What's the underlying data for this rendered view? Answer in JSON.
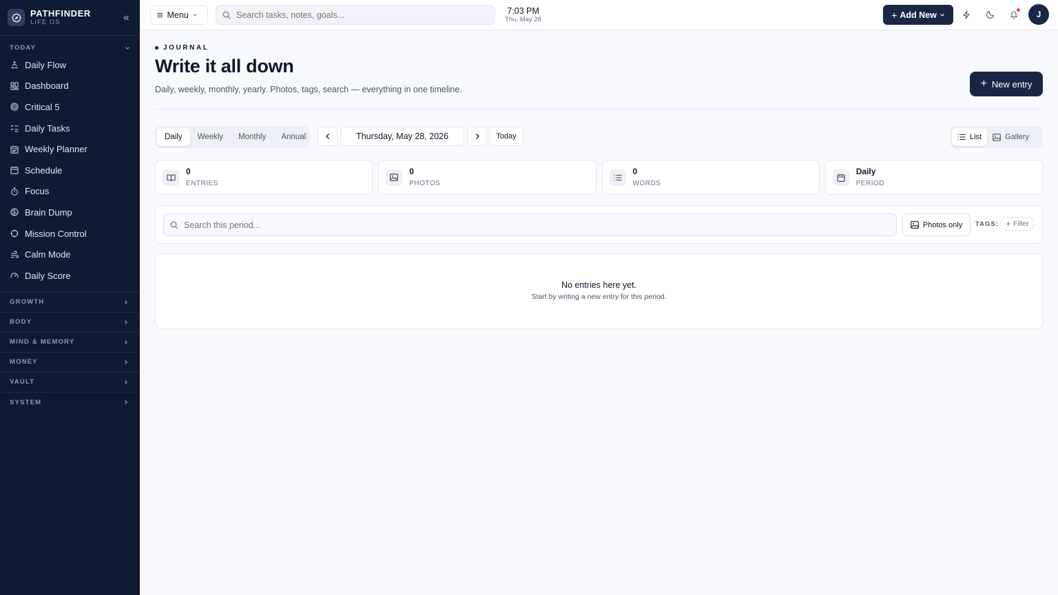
{
  "brand": {
    "name": "PATHFINDER",
    "sub": "LIFE OS"
  },
  "sidebar": {
    "today_label": "TODAY",
    "items": [
      {
        "label": "Daily Flow",
        "icon": "sunrise-icon"
      },
      {
        "label": "Dashboard",
        "icon": "grid-icon"
      },
      {
        "label": "Critical 5",
        "icon": "target-icon"
      },
      {
        "label": "Daily Tasks",
        "icon": "list-checks-icon"
      },
      {
        "label": "Weekly Planner",
        "icon": "calendar-week-icon"
      },
      {
        "label": "Schedule",
        "icon": "calendar-icon"
      },
      {
        "label": "Focus",
        "icon": "timer-icon"
      },
      {
        "label": "Brain Dump",
        "icon": "brain-icon"
      },
      {
        "label": "Mission Control",
        "icon": "crosshair-icon"
      },
      {
        "label": "Calm Mode",
        "icon": "wind-icon"
      },
      {
        "label": "Daily Score",
        "icon": "gauge-icon"
      }
    ],
    "sections": [
      "GROWTH",
      "BODY",
      "MIND & MEMORY",
      "MONEY",
      "VAULT",
      "SYSTEM"
    ]
  },
  "topbar": {
    "menu_label": "Menu",
    "search_placeholder": "Search tasks, notes, goals...",
    "time": "7:03 PM",
    "date": "Thu, May 28",
    "add_new_label": "Add New",
    "avatar_initial": "J"
  },
  "page": {
    "eyebrow": "JOURNAL",
    "title": "Write it all down",
    "subtitle": "Daily, weekly, monthly, yearly. Photos, tags, search — everything in one timeline.",
    "new_entry_label": "New entry"
  },
  "period_tabs": [
    "Daily",
    "Weekly",
    "Monthly",
    "Annual"
  ],
  "active_period": "Daily",
  "current_date": "Thursday, May 28, 2026",
  "today_label": "Today",
  "view_toggle": {
    "list": "List",
    "gallery": "Gallery",
    "active": "List"
  },
  "stats": [
    {
      "value": "0",
      "label": "ENTRIES",
      "icon": "book-open-icon"
    },
    {
      "value": "0",
      "label": "PHOTOS",
      "icon": "image-icon"
    },
    {
      "value": "0",
      "label": "WORDS",
      "icon": "list-icon"
    },
    {
      "value": "Daily",
      "label": "PERIOD",
      "icon": "calendar-icon"
    }
  ],
  "filter": {
    "search_placeholder": "Search this period...",
    "photos_only_label": "Photos only",
    "tags_label": "TAGS:",
    "filter_chip_label": "Filter"
  },
  "empty": {
    "title": "No entries here yet.",
    "subtitle": "Start by writing a new entry for this period."
  },
  "colors": {
    "sidebar_bg": "#0f1b33",
    "primary": "#1a2744",
    "page_bg": "#f8f9fc",
    "notification": "#ef4444"
  }
}
